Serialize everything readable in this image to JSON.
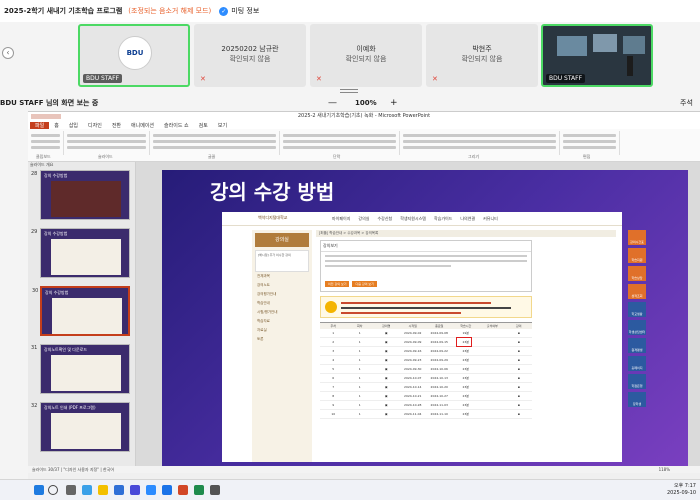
{
  "meeting": {
    "title": "2025-2학기 새내기 기초학습 프로그램",
    "mode": "(조정되는 음소거 해제 모드)",
    "info_label": "미팅 정보",
    "nav_arrow": "‹"
  },
  "participants": [
    {
      "name": "",
      "status": "",
      "footer": "BDU STAFF",
      "logo": "BDU",
      "active": true
    },
    {
      "name": "20250202 남규란",
      "status": "확인되지 않음",
      "footer": ""
    },
    {
      "name": "이예화",
      "status": "확인되지 않음",
      "footer": ""
    },
    {
      "name": "박현주",
      "status": "확인되지 않음",
      "footer": ""
    },
    {
      "name": "",
      "status": "",
      "footer": "BDU STAFF",
      "active": true
    }
  ],
  "view": {
    "viewer_text": "BDU STAFF 님의 화면 보는 중",
    "zoom_minus": "—",
    "zoom_value": "100%",
    "zoom_plus": "+",
    "annotate": "주석"
  },
  "ppt": {
    "window_title": "2025-2 새내기기초학습(기초) 녹화 - Microsoft PowerPoint",
    "tabs": [
      "파일",
      "홈",
      "삽입",
      "디자인",
      "전환",
      "애니메이션",
      "슬라이드 쇼",
      "검토",
      "보기"
    ],
    "groups": [
      "클립보드",
      "슬라이드",
      "글꼴",
      "단락",
      "그리기",
      "편집"
    ],
    "thumbs_header": "슬라이드  개요",
    "slides": [
      {
        "num": "28",
        "title": "강의 수강방법"
      },
      {
        "num": "29",
        "title": "강의 수강방법"
      },
      {
        "num": "30",
        "title": "강의 수강방법"
      },
      {
        "num": "31",
        "title": "강의노트확인 및 다운로드"
      },
      {
        "num": "32",
        "title": "강의노트 인쇄 (PDF 프로그램)"
      }
    ],
    "status_bar": "슬라이드 30/37  |  \"디자인 사용자 지정\"  |  한국어",
    "zoom_pct": "118%"
  },
  "slide": {
    "title": "강의 수강 방법",
    "web": {
      "logo": "백석디지털대학교",
      "nav": [
        "마이페이지",
        "강의실",
        "수강신청",
        "학생지원시스템",
        "학습가이드",
        "나의연결",
        "커뮤니티"
      ],
      "side_box": "강의실",
      "side_user": "[해시정] 추가 이수한 강의",
      "menu": [
        "전체과목",
        "강의노트",
        "강의평가안내",
        "학습안내",
        "시험/평가안내",
        "학습자료",
        "자료실",
        "토론"
      ],
      "crumb": "[퍼플] 학습안내  >  수강과목  >  강의목록",
      "panel_title": "강의보기",
      "panel_buttons": [
        "이전 강의 보기",
        "다음 강의 보기"
      ],
      "table_head": [
        "주차",
        "회차",
        "강의명",
        "시작일",
        "종료일",
        "학습시간",
        "출석여부",
        "강의"
      ],
      "rows": [
        {
          "week": "1",
          "lec": "1",
          "start": "2024-09-02",
          "end": "2024-09-08",
          "time": "19분"
        },
        {
          "week": "2",
          "lec": "1",
          "start": "2024-09-09",
          "end": "2024-09-15",
          "time": "23분"
        },
        {
          "week": "3",
          "lec": "1",
          "start": "2024-09-16",
          "end": "2024-09-22",
          "time": "23분"
        },
        {
          "week": "4",
          "lec": "1",
          "start": "2024-09-23",
          "end": "2024-09-29",
          "time": "23분"
        },
        {
          "week": "5",
          "lec": "1",
          "start": "2024-09-30",
          "end": "2024-10-06",
          "time": "23분"
        },
        {
          "week": "6",
          "lec": "1",
          "start": "2024-10-07",
          "end": "2024-10-13",
          "time": "23분"
        },
        {
          "week": "7",
          "lec": "1",
          "start": "2024-10-14",
          "end": "2024-10-20",
          "time": "23분"
        },
        {
          "week": "8",
          "lec": "1",
          "start": "2024-10-21",
          "end": "2024-10-27",
          "time": "23분"
        },
        {
          "week": "9",
          "lec": "1",
          "start": "2024-10-28",
          "end": "2024-11-03",
          "time": "23분"
        },
        {
          "week": "10",
          "lec": "1",
          "start": "2024-11-04",
          "end": "2024-11-10",
          "time": "23분"
        }
      ],
      "quick_links": [
        "강의시간표",
        "학습지원",
        "학습상담",
        "성적조회",
        "학교생활",
        "학생상담센터",
        "원격평생",
        "홈페이지",
        "학점은행",
        "장학생"
      ]
    }
  },
  "taskbar": {
    "time": "오후 7:17",
    "date": "2025-09-10"
  }
}
